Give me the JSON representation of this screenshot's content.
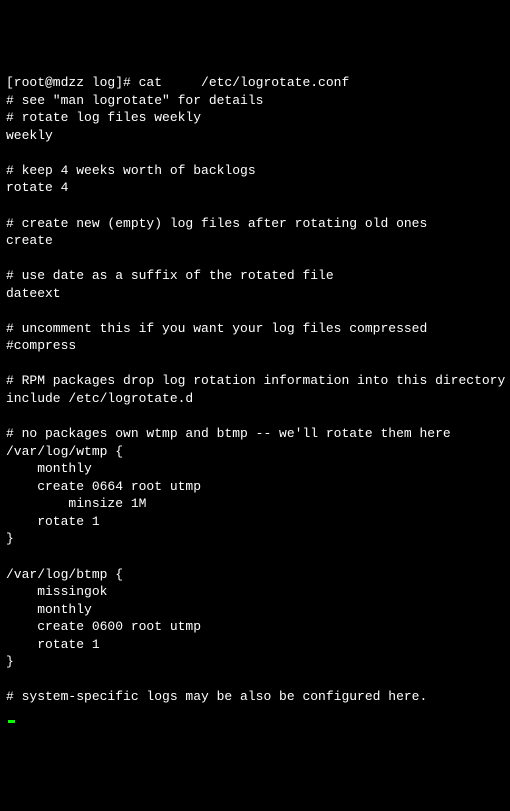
{
  "prompt": "[root@mdzz log]# cat     /etc/logrotate.conf",
  "lines": [
    "# see \"man logrotate\" for details",
    "# rotate log files weekly",
    "weekly",
    "",
    "# keep 4 weeks worth of backlogs",
    "rotate 4",
    "",
    "# create new (empty) log files after rotating old ones",
    "create",
    "",
    "# use date as a suffix of the rotated file",
    "dateext",
    "",
    "# uncomment this if you want your log files compressed",
    "#compress",
    "",
    "# RPM packages drop log rotation information into this directory",
    "include /etc/logrotate.d",
    "",
    "# no packages own wtmp and btmp -- we'll rotate them here",
    "/var/log/wtmp {",
    "    monthly",
    "    create 0664 root utmp",
    "        minsize 1M",
    "    rotate 1",
    "}",
    "",
    "/var/log/btmp {",
    "    missingok",
    "    monthly",
    "    create 0600 root utmp",
    "    rotate 1",
    "}",
    "",
    "# system-specific logs may be also be configured here."
  ]
}
